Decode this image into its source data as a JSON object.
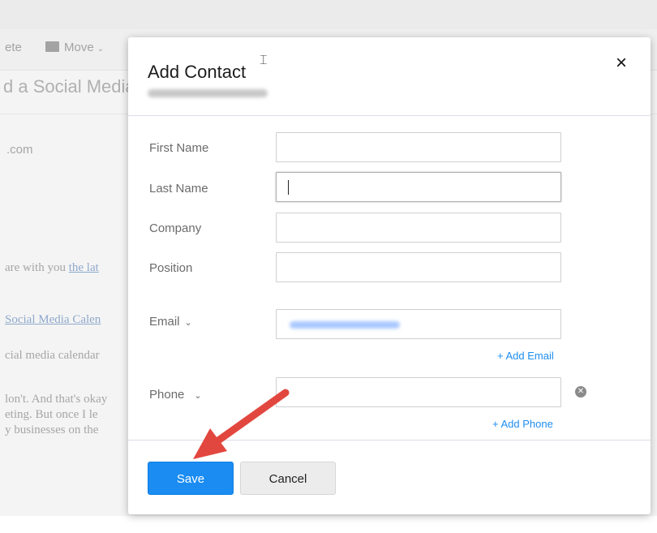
{
  "background": {
    "toolbar": {
      "delete_label": "ete",
      "move_label": "Move"
    },
    "subject": "d a Social Media",
    "sender": ".com",
    "body_lines": [
      {
        "text": "are with you ",
        "link": "the lat"
      },
      {
        "text": "",
        "link": "Social Media Calen"
      },
      {
        "text": "cial media calendar",
        "link": ""
      },
      {
        "text": "lon't. And that's okay",
        "link": ""
      },
      {
        "text": "eting. But once I le",
        "link": ""
      },
      {
        "text": "y businesses on the",
        "link": ""
      }
    ]
  },
  "modal": {
    "title": "Add Contact",
    "close_glyph": "×",
    "fields": {
      "first_name": {
        "label": "First Name",
        "value": ""
      },
      "last_name": {
        "label": "Last Name",
        "value": ""
      },
      "company": {
        "label": "Company",
        "value": ""
      },
      "position": {
        "label": "Position",
        "value": ""
      },
      "email": {
        "label": "Email",
        "value": ""
      },
      "phone": {
        "label": "Phone",
        "value": ""
      }
    },
    "add_email_label": "+ Add Email",
    "add_phone_label": "+ Add Phone",
    "save_label": "Save",
    "cancel_label": "Cancel"
  },
  "colors": {
    "primary": "#1a8cf2",
    "link": "#1e8ef0",
    "annotation_arrow": "#e2473f"
  },
  "icons": {
    "close": "close-icon",
    "chevron": "chevron-down-icon",
    "folder": "folder-icon",
    "remove": "remove-circle-icon"
  }
}
